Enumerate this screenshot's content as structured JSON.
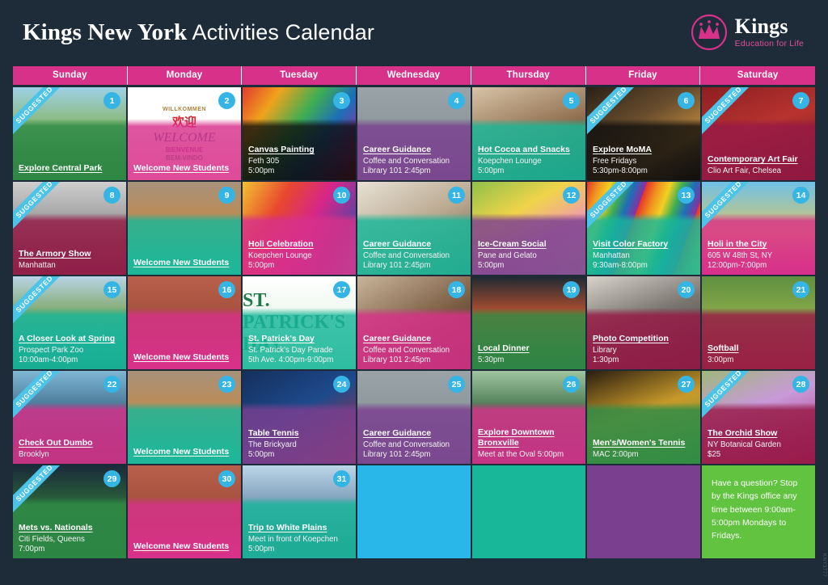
{
  "header": {
    "title_strong": "Kings New York",
    "title_light": " Activities Calendar",
    "logo_name": "Kings",
    "logo_tagline": "Education for Life",
    "brand_pink": "#d8318a",
    "bg_dark": "#1e2c3a"
  },
  "calendar": {
    "day_headers": [
      "Sunday",
      "Monday",
      "Tuesday",
      "Wednesday",
      "Thursday",
      "Friday",
      "Saturday"
    ],
    "suggested_ribbon_label": "SUGGESTED",
    "side_code": "KNY3777",
    "cells": [
      {
        "date": "1",
        "title": "Explore Central Park",
        "lines": [],
        "suggested": true,
        "bg": "bg-park",
        "ov": "ov-green"
      },
      {
        "date": "2",
        "title": "Welcome New Students",
        "lines": [],
        "suggested": false,
        "bg": "bg-welcome-w",
        "ov": "ov-pink",
        "art": "welcome-multi"
      },
      {
        "date": "3",
        "title": "Canvas Painting",
        "lines": [
          "Feth 305",
          "5:00pm"
        ],
        "suggested": false,
        "bg": "bg-canvas",
        "ov": "ov-dark"
      },
      {
        "date": "4",
        "title": "Career Guidance",
        "lines": [
          "Coffee and Conversation",
          "Library 101 2:45pm"
        ],
        "suggested": false,
        "bg": "bg-arrows",
        "ov": "ov-purple"
      },
      {
        "date": "5",
        "title": "Hot Cocoa and Snacks",
        "lines": [
          "Koepchen Lounge",
          "5:00pm"
        ],
        "suggested": false,
        "bg": "bg-cocoa",
        "ov": "ov-teal"
      },
      {
        "date": "6",
        "title": "Explore MoMA",
        "lines": [
          "Free Fridays",
          "5:30pm-8:00pm"
        ],
        "suggested": true,
        "bg": "bg-moma",
        "ov": "ov-dark"
      },
      {
        "date": "7",
        "title": "Contemporary Art Fair",
        "lines": [
          "Clio Art Fair, Chelsea"
        ],
        "suggested": true,
        "bg": "bg-artfair",
        "ov": "ov-maroon"
      },
      {
        "date": "8",
        "title": "The Armory Show",
        "lines": [
          "Manhattan"
        ],
        "suggested": true,
        "bg": "bg-armory",
        "ov": "ov-maroon"
      },
      {
        "date": "9",
        "title": "Welcome New Students",
        "lines": [],
        "suggested": false,
        "bg": "bg-doormat",
        "ov": "ov-teal"
      },
      {
        "date": "10",
        "title": "Holi Celebration",
        "lines": [
          "Koepchen Lounge",
          "5:00pm"
        ],
        "suggested": false,
        "bg": "bg-holi",
        "ov": "ov-pink"
      },
      {
        "date": "11",
        "title": "Career Guidance",
        "lines": [
          "Coffee and Conversation",
          "Library 101 2:45pm"
        ],
        "suggested": false,
        "bg": "bg-career",
        "ov": "ov-teal"
      },
      {
        "date": "12",
        "title": "Ice-Cream Social",
        "lines": [
          "Pane and Gelato",
          "5:00pm"
        ],
        "suggested": false,
        "bg": "bg-icecream",
        "ov": "ov-purple"
      },
      {
        "date": "13",
        "title": "Visit Color Factory",
        "lines": [
          "Manhattan",
          "9:30am-8:00pm"
        ],
        "suggested": true,
        "bg": "bg-color",
        "ov": "ov-teal"
      },
      {
        "date": "14",
        "title": "Holi in the City",
        "lines": [
          "605 W 48th St, NY",
          "12:00pm-7:00pm"
        ],
        "suggested": true,
        "bg": "bg-holicity",
        "ov": "ov-pink"
      },
      {
        "date": "15",
        "title": "A Closer Look at Spring",
        "lines": [
          "Prospect Park Zoo",
          "10:00am-4:00pm"
        ],
        "suggested": true,
        "bg": "bg-spring",
        "ov": "ov-teal"
      },
      {
        "date": "16",
        "title": "Welcome New Students",
        "lines": [],
        "suggested": false,
        "bg": "bg-brickwel",
        "ov": "ov-pink"
      },
      {
        "date": "17",
        "title": "St. Patrick's Day",
        "lines": [
          "St. Patrick's Day Parade",
          "5th Ave. 4:00pm-9:00pm"
        ],
        "suggested": false,
        "bg": "bg-stpat",
        "ov": "ov-teal",
        "art": "stpatrick"
      },
      {
        "date": "18",
        "title": "Career Guidance",
        "lines": [
          "Coffee and Conversation",
          "Library 101 2:45pm"
        ],
        "suggested": false,
        "bg": "bg-coffee",
        "ov": "ov-pink"
      },
      {
        "date": "19",
        "title": "Local Dinner",
        "lines": [
          "5:30pm"
        ],
        "suggested": false,
        "bg": "bg-diner",
        "ov": "ov-green"
      },
      {
        "date": "20",
        "title": "Photo Competition",
        "lines": [
          "Library",
          "1:30pm"
        ],
        "suggested": false,
        "bg": "bg-camera",
        "ov": "ov-maroon"
      },
      {
        "date": "21",
        "title": "Softball",
        "lines": [
          "3:00pm"
        ],
        "suggested": false,
        "bg": "bg-softball",
        "ov": "ov-maroon"
      },
      {
        "date": "22",
        "title": "Check Out Dumbo",
        "lines": [
          "Brooklyn"
        ],
        "suggested": true,
        "bg": "bg-dumbo",
        "ov": "ov-pink"
      },
      {
        "date": "23",
        "title": "Welcome New Students",
        "lines": [],
        "suggested": false,
        "bg": "bg-doormat",
        "ov": "ov-teal"
      },
      {
        "date": "24",
        "title": "Table Tennis",
        "lines": [
          "The Brickyard",
          "5:00pm"
        ],
        "suggested": false,
        "bg": "bg-pingpong",
        "ov": "ov-purple"
      },
      {
        "date": "25",
        "title": "Career Guidance",
        "lines": [
          "Coffee and Conversation",
          "Library 101 2:45pm"
        ],
        "suggested": false,
        "bg": "bg-arrows",
        "ov": "ov-purple"
      },
      {
        "date": "26",
        "title": "Explore Downtown Bronxville",
        "lines": [
          "Meet at the Oval 5:00pm"
        ],
        "suggested": false,
        "bg": "bg-train",
        "ov": "ov-pink"
      },
      {
        "date": "27",
        "title": "Men's/Women's Tennis",
        "lines": [
          "MAC 2:00pm"
        ],
        "suggested": false,
        "bg": "bg-tennis",
        "ov": "ov-green"
      },
      {
        "date": "28",
        "title": "The Orchid Show",
        "lines": [
          "NY Botanical Garden",
          "$25"
        ],
        "suggested": true,
        "bg": "bg-orchid",
        "ov": "ov-maroon"
      },
      {
        "date": "29",
        "title": "Mets vs. Nationals",
        "lines": [
          "Citi Fields, Queens",
          "7:00pm"
        ],
        "suggested": true,
        "bg": "bg-mets",
        "ov": "ov-green"
      },
      {
        "date": "30",
        "title": "Welcome New Students",
        "lines": [],
        "suggested": false,
        "bg": "bg-brickwel",
        "ov": "ov-pink"
      },
      {
        "date": "31",
        "title": "Trip to White Plains",
        "lines": [
          "Meet in front of Koepchen",
          "5:00pm"
        ],
        "suggested": false,
        "bg": "bg-whiteplns",
        "ov": "ov-teal"
      }
    ],
    "filler_cells": [
      "empty-blue",
      "empty-teal",
      "empty-purple"
    ],
    "note": "Have a question? Stop by the Kings office any time between 9:00am-5:00pm Mondays to Fridays."
  },
  "welcome_art": {
    "l1": "WILLKOMMEN",
    "l2": "欢迎",
    "l3": "WELCOME",
    "l4": "BIENVENUE",
    "l5": "BEM-VINDO"
  },
  "stpatrick_art": {
    "label": "ST. PATRICK'S DAY"
  }
}
